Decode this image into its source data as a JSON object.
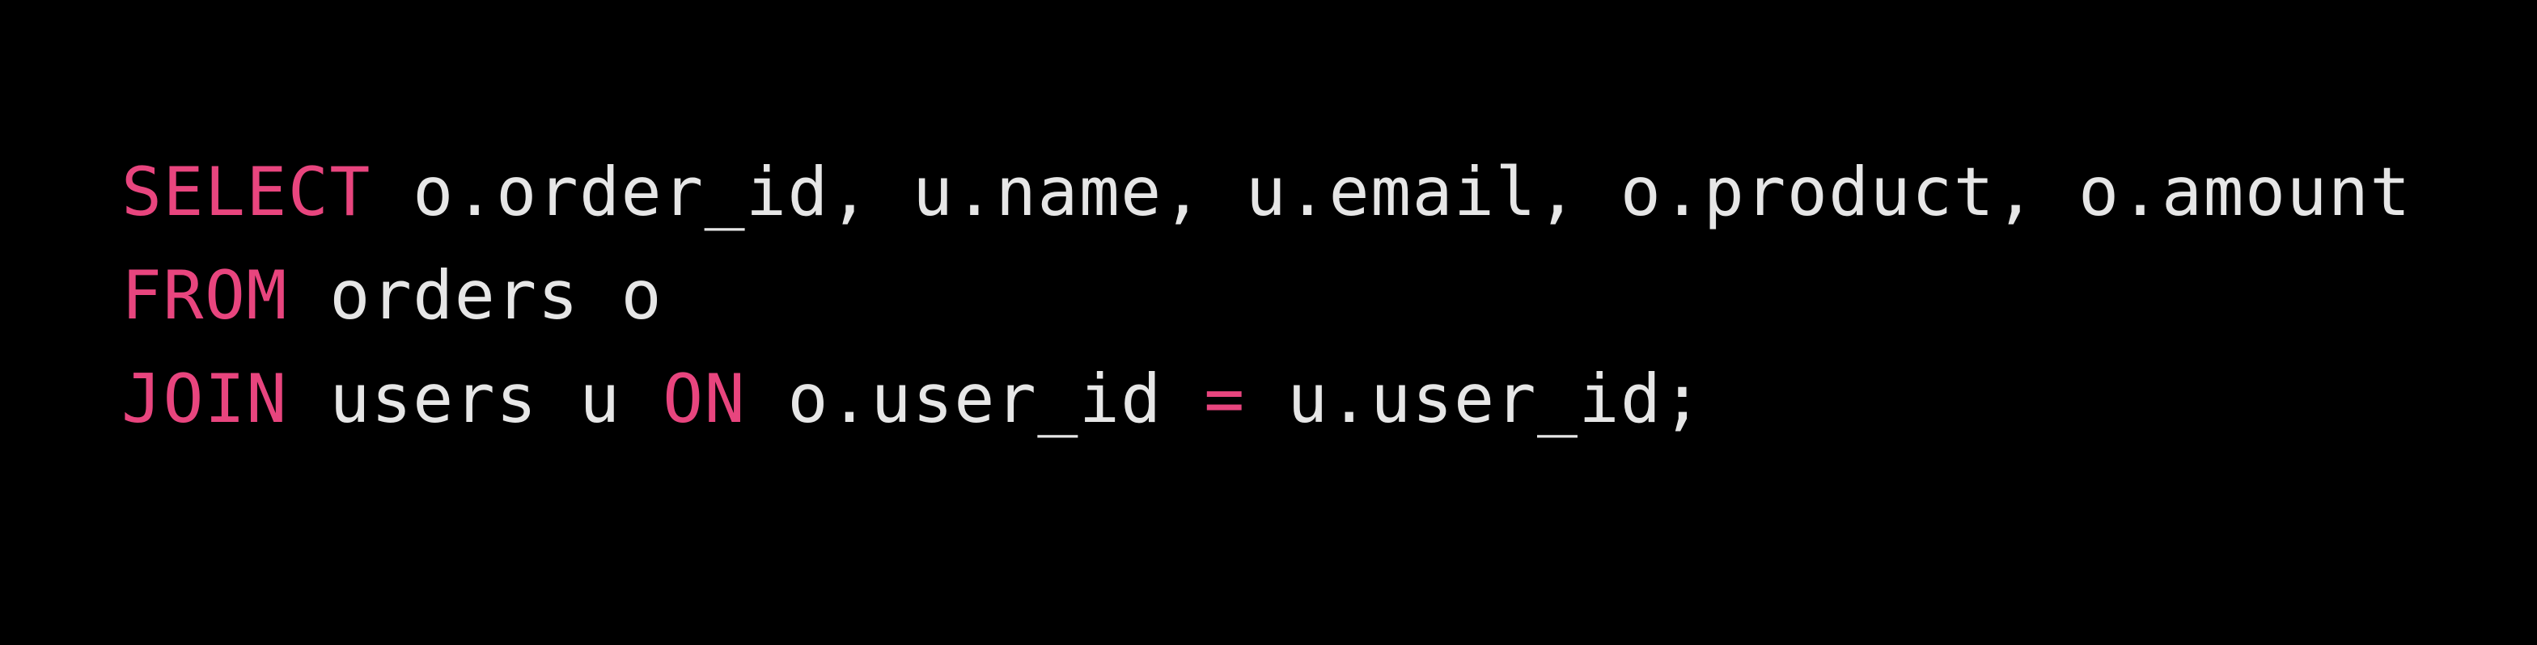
{
  "colors": {
    "background": "#000000",
    "keyword": "#e8457e",
    "text": "#e6e6e6"
  },
  "code": {
    "line1": {
      "kw_select": "SELECT",
      "columns": " o.order_id, u.name, u.email, o.product, o.amount"
    },
    "line2": {
      "kw_from": "FROM",
      "table": " orders o"
    },
    "line3": {
      "kw_join": "JOIN",
      "table": " users u ",
      "kw_on": "ON",
      "left": " o.user_id ",
      "op_eq": "=",
      "right": " u.user_id;"
    }
  }
}
